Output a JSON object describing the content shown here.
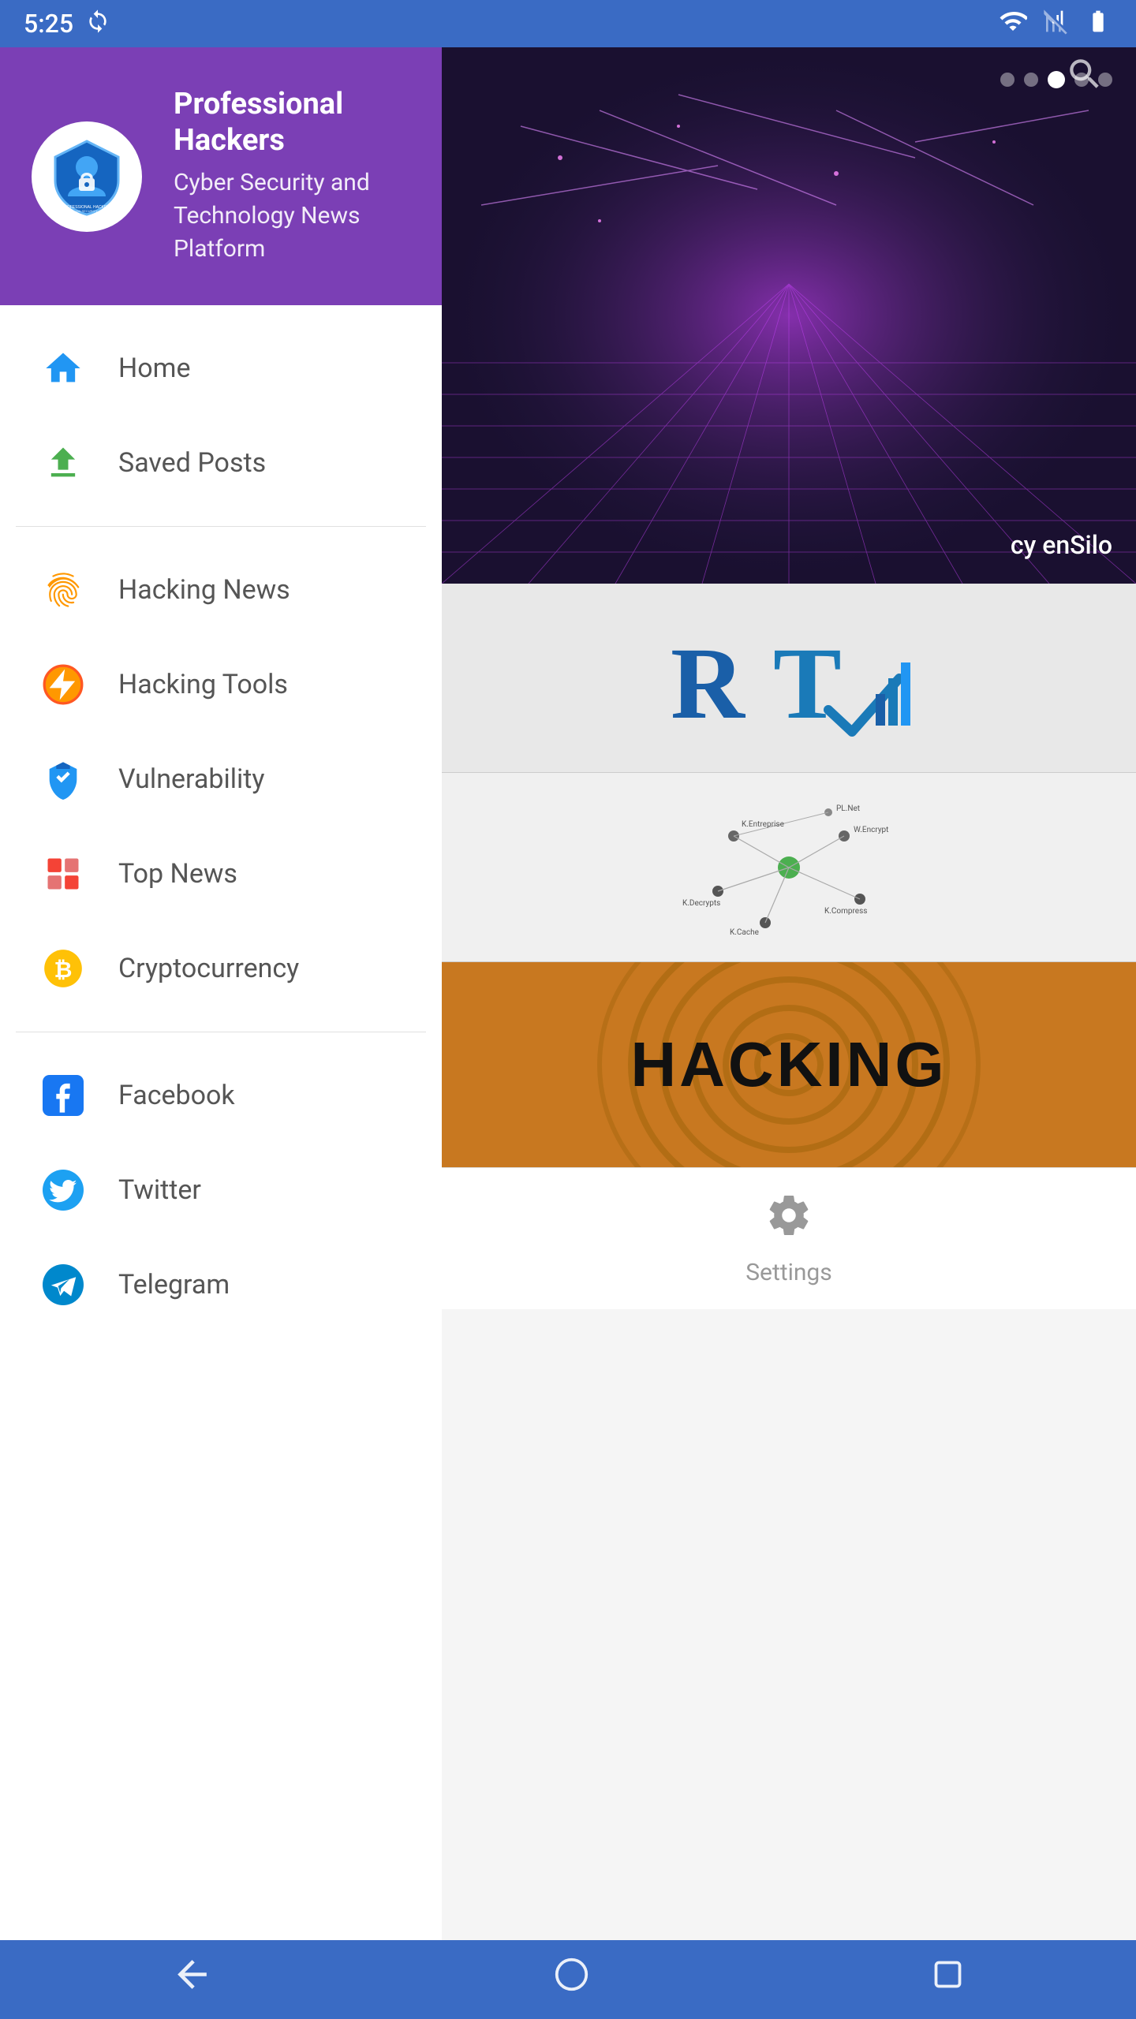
{
  "statusBar": {
    "time": "5:25",
    "icons": [
      "sync-icon",
      "wifi-icon",
      "signal-icon",
      "battery-icon"
    ]
  },
  "drawer": {
    "header": {
      "appName": "Professional Hackers",
      "subtitle": "Cyber Security and Technology News Platform"
    },
    "menuGroups": [
      {
        "items": [
          {
            "id": "home",
            "label": "Home",
            "iconType": "home"
          },
          {
            "id": "saved-posts",
            "label": "Saved Posts",
            "iconType": "save"
          }
        ]
      },
      {
        "items": [
          {
            "id": "hacking-news",
            "label": "Hacking News",
            "iconType": "fingerprint"
          },
          {
            "id": "hacking-tools",
            "label": "Hacking Tools",
            "iconType": "lightning"
          },
          {
            "id": "vulnerability",
            "label": "Vulnerability",
            "iconType": "shield"
          },
          {
            "id": "top-news",
            "label": "Top News",
            "iconType": "grid"
          },
          {
            "id": "cryptocurrency",
            "label": "Cryptocurrency",
            "iconType": "bitcoin"
          }
        ]
      },
      {
        "items": [
          {
            "id": "facebook",
            "label": "Facebook",
            "iconType": "facebook"
          },
          {
            "id": "twitter",
            "label": "Twitter",
            "iconType": "twitter"
          },
          {
            "id": "telegram",
            "label": "Telegram",
            "iconType": "telegram"
          }
        ]
      }
    ]
  },
  "rightPanel": {
    "bannerText": "cy enSilo",
    "dots": [
      "inactive",
      "inactive",
      "active",
      "inactive",
      "inactive"
    ],
    "cards": [
      {
        "type": "rt-logo",
        "text": "RT"
      },
      {
        "type": "network",
        "text": ""
      },
      {
        "type": "hacking",
        "text": "HACKING"
      }
    ],
    "settings": {
      "label": "Settings"
    }
  },
  "navBar": {
    "buttons": [
      "back",
      "home",
      "recent"
    ]
  }
}
